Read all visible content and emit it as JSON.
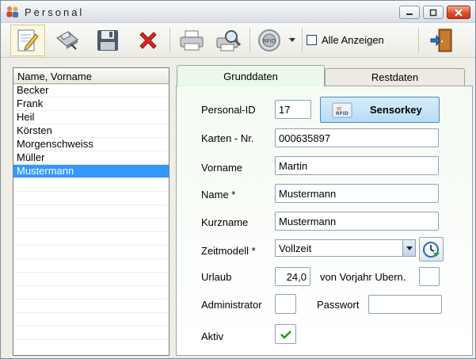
{
  "window": {
    "title": "Personal"
  },
  "titlebar_buttons": {
    "minimize": "▬",
    "maximize": "▢",
    "close": "✕"
  },
  "toolbar": {
    "icons": [
      "edit-icon",
      "card-reader-icon",
      "save-icon",
      "delete-icon",
      "print-icon",
      "print-preview-icon",
      "rfid-icon",
      "dropdown-arrow-icon",
      "exit-icon"
    ],
    "show_all_label": "Alle Anzeigen",
    "show_all_checked": false
  },
  "list": {
    "header": "Name, Vorname",
    "items": [
      "Becker",
      "Frank",
      "Heil",
      "Körsten",
      "Morgenschweiss",
      "Müller",
      "Mustermann"
    ],
    "selected": "Mustermann"
  },
  "tabs": [
    {
      "label": "Grunddaten",
      "selected": true
    },
    {
      "label": "Restdaten",
      "selected": false
    }
  ],
  "form": {
    "personal_id_label": "Personal-ID",
    "personal_id_value": "17",
    "sensor_button_label": "Sensorkey",
    "card_label": "Karten - Nr.",
    "card_value": "000635897",
    "firstname_label": "Vorname",
    "firstname_value": "Martin",
    "name_label": "Name *",
    "name_value": "Mustermann",
    "shortname_label": "Kurzname",
    "shortname_value": "Mustermann",
    "timemodel_label": "Zeitmodell *",
    "timemodel_value": "Vollzeit",
    "vacation_label": "Urlaub",
    "vacation_value": "24,0",
    "prev_year_label": "von Vorjahr Ubern.",
    "prev_year_value": "",
    "admin_label": "Administrator",
    "admin_checked": false,
    "password_label": "Passwort",
    "password_value": "",
    "active_label": "Aktiv",
    "active_checked": true
  },
  "colors": {
    "selection": "#3399ff",
    "accent": "#1d9a1d"
  }
}
